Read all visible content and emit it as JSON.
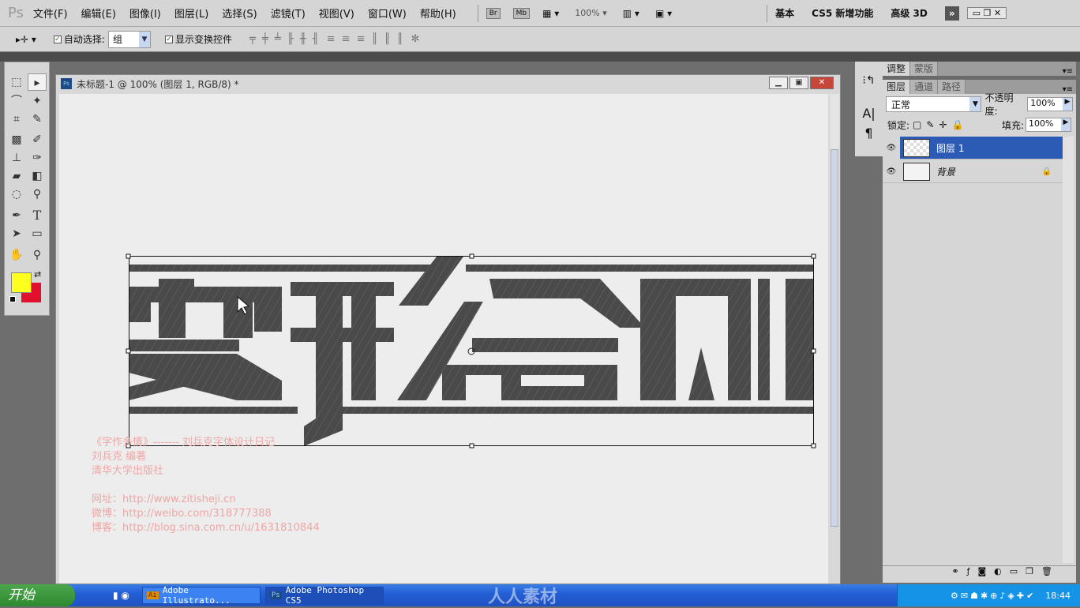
{
  "app": {
    "logo": "Ps"
  },
  "menu": [
    "文件(F)",
    "编辑(E)",
    "图像(I)",
    "图层(L)",
    "选择(S)",
    "滤镜(T)",
    "视图(V)",
    "窗口(W)",
    "帮助(H)"
  ],
  "appbar": {
    "br": "Br",
    "mb": "Mb",
    "zoom": "100%",
    "workspaces": [
      "基本",
      "CS5 新增功能",
      "高级 3D"
    ],
    "more": "»"
  },
  "options": {
    "auto_select_label": "自动选择:",
    "auto_select_checked": true,
    "auto_select_value": "组",
    "show_transform_label": "显示变换控件",
    "show_transform_checked": true
  },
  "document": {
    "title": "未标题-1 @ 100% (图层 1, RGB/8) *"
  },
  "colors": {
    "foreground": "#ffff1e",
    "background": "#e0102e",
    "accent": "#2a5cb8"
  },
  "credits": {
    "lines": [
      "《字作多情》------- 刘兵克字体设计日记",
      "刘兵克  编著",
      "清华大学出版社",
      "",
      "网址：http://www.zitisheji.cn",
      "微博：http://weibo.com/318777388",
      "博客：http://blog.sina.com.cn/u/1631810844"
    ]
  },
  "panels": {
    "top_tabs": [
      "调整",
      "蒙版"
    ],
    "layer_tabs": [
      "图层",
      "通道",
      "路径"
    ],
    "blend_mode": "正常",
    "opacity_label": "不透明度:",
    "opacity": "100%",
    "lock_label": "锁定:",
    "fill_label": "填充:",
    "fill": "100%",
    "layers": [
      {
        "name": "图层 1",
        "selected": true,
        "visible": true
      },
      {
        "name": "背景",
        "selected": false,
        "visible": true,
        "locked": true
      }
    ]
  },
  "taskbar": {
    "start": "开始",
    "tasks": [
      "Adobe Illustrato...",
      "Adobe Photoshop CS5"
    ],
    "clock": "18:44",
    "watermark": "人人素材"
  }
}
